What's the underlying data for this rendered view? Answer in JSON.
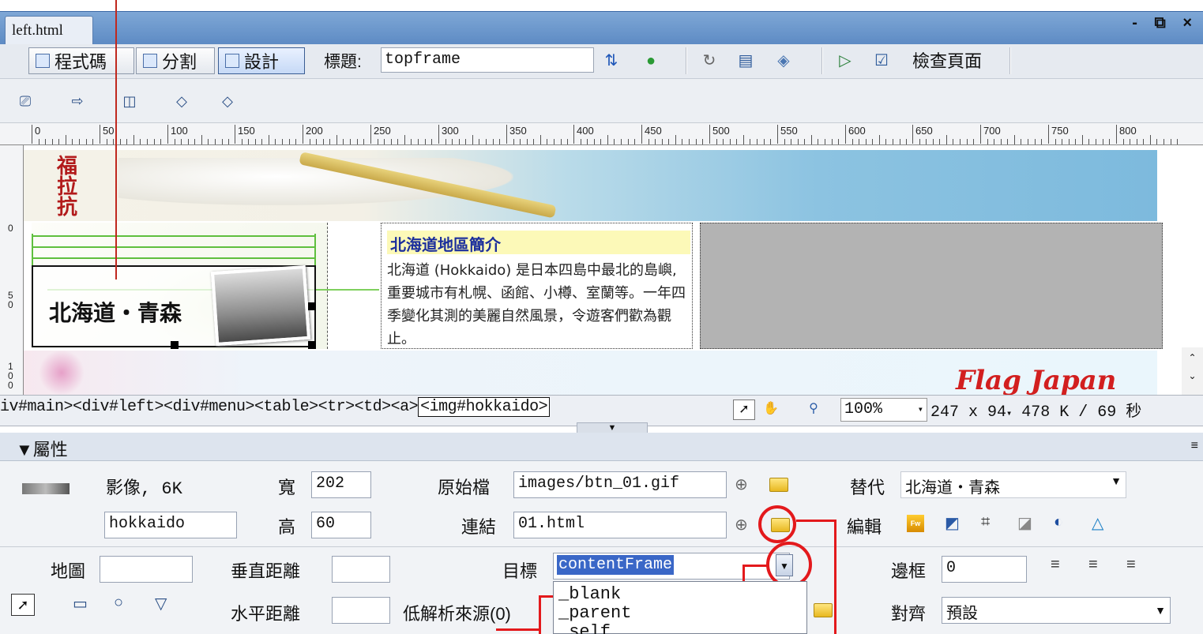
{
  "window": {
    "tab_title": "left.html",
    "controls": "- ⧉ ×"
  },
  "doc_toolbar": {
    "code_btn": "程式碼",
    "split_btn": "分割",
    "design_btn": "設計",
    "title_label": "標題:",
    "title_value": "topframe",
    "check_page": "檢查頁面"
  },
  "ruler": {
    "marks": [
      "0",
      "50",
      "100",
      "150",
      "200",
      "250",
      "300",
      "350",
      "400",
      "450",
      "500",
      "550",
      "600",
      "650",
      "700",
      "750",
      "800"
    ],
    "v_marks": [
      "0",
      "5 0",
      "1 0 0"
    ]
  },
  "canvas": {
    "banner_vertical_text": "福\n拉\n抗",
    "menu_image_label": "北海道・青森",
    "info_title": "北海道地區簡介",
    "info_body": "北海道 (Hokkaido) 是日本四島中最北的島嶼, 重要城市有札幌、函館、小樽、室蘭等。一年四季變化其測的美麗自然風景，令遊客們歡為觀止。",
    "brand": "Flag Japan"
  },
  "statusbar": {
    "tags_prefix": "iv#main><div#left><div#menu><table><tr><td><a>",
    "tag_current": "<img#hokkaido>",
    "zoom": "100%",
    "dimensions": "247 x 94",
    "size_time": "478 K / 69 秒"
  },
  "properties": {
    "panel_title": "屬性",
    "type_label": "影像, 6K",
    "id_value": "hokkaido",
    "width_label": "寬",
    "width_value": "202",
    "height_label": "高",
    "height_value": "60",
    "src_label": "原始檔",
    "src_value": "images/btn_01.gif",
    "link_label": "連結",
    "link_value": "01.html",
    "alt_label": "替代",
    "alt_value": "北海道・青森",
    "edit_label": "編輯",
    "map_label": "地圖",
    "map_value": "",
    "vspace_label": "垂直距離",
    "vspace_value": "",
    "hspace_label": "水平距離",
    "hspace_value": "",
    "target_label": "目標",
    "target_value": "contentFrame",
    "target_options": [
      "_blank",
      "_parent",
      "_self"
    ],
    "lowsrc_label": "低解析來源(0)",
    "border_label": "邊框",
    "border_value": "0",
    "align_label": "對齊",
    "align_value": "預設"
  }
}
